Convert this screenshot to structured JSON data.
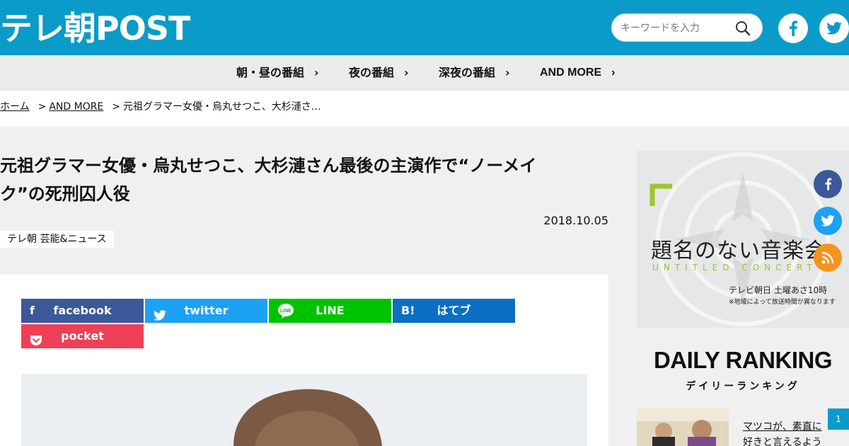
{
  "header": {
    "logo": "テレ朝POST",
    "search_placeholder": "キーワードを入力"
  },
  "nav": {
    "items": [
      {
        "label": "朝・昼の番組"
      },
      {
        "label": "夜の番組"
      },
      {
        "label": "深夜の番組"
      },
      {
        "label": "AND MORE"
      }
    ]
  },
  "breadcrumb": {
    "home": "ホーム",
    "category": "AND MORE",
    "current": "元祖グラマー女優・烏丸せつこ、大杉漣さ…",
    "separator": ">"
  },
  "article": {
    "title": "元祖グラマー女優・烏丸せつこ、大杉漣さん最後の主演作で“ノーメイク”の死刑囚人役",
    "date": "2018.10.05",
    "tag": "テレ朝 芸能&ニュース"
  },
  "share": {
    "facebook": "facebook",
    "twitter": "twitter",
    "line": "LINE",
    "hatena": "はてブ",
    "hatena_icon": "B!",
    "pocket": "pocket",
    "colors": {
      "facebook": "#3b5998",
      "twitter": "#1da1f2",
      "line": "#00c300",
      "hatena": "#0a6fc2",
      "pocket": "#ef3f56"
    }
  },
  "sidebar": {
    "banner": {
      "title": "題名のない音楽会",
      "subtitle": "UNTITLED CONCERT",
      "channel": "テレビ朝日 土曜あさ10時",
      "note": "※地域によって放送時間が異なります"
    },
    "ranking": {
      "title": "DAILY RANKING",
      "subtitle": "デイリーランキング",
      "items": [
        {
          "rank": "1",
          "text": "マツコが、素直に好きと言えるよう"
        }
      ]
    }
  },
  "colors": {
    "brand": "#0b9bc8",
    "rss": "#f7921e"
  }
}
